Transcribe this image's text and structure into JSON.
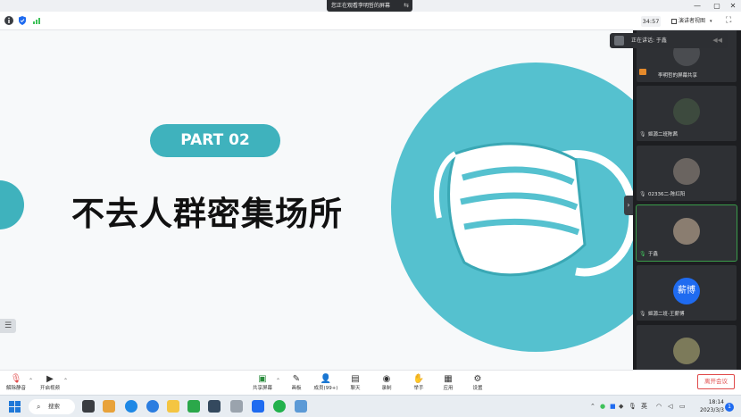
{
  "title_bar": {
    "sharing_text": "您正在观看李明哲的屏幕",
    "minimize": "—",
    "maximize": "▢",
    "close": "✕"
  },
  "info_bar": {
    "timer": "34:57",
    "view_mode": "演讲者视图",
    "icons": [
      "info-icon",
      "shield-icon",
      "signal-icon",
      "fullscreen-icon"
    ]
  },
  "slide": {
    "part_label": "PART 02",
    "title": "不去人群密集场所",
    "colors": {
      "teal": "#3fb2bd",
      "mask_circle": "#55c1cf"
    }
  },
  "panel": {
    "speaking_label": "正在讲话: 于鑫",
    "participants": [
      {
        "name": "李明哲的屏幕共享",
        "avatar": ""
      },
      {
        "name": "姬源二班陈茜",
        "avatar": ""
      },
      {
        "name": "02336二-陈红阳",
        "avatar": ""
      },
      {
        "name": "于鑫",
        "avatar": "",
        "speaking": true
      },
      {
        "name": "姬源二班-王薪博",
        "avatar": "薪博"
      },
      {
        "name": "",
        "avatar": ""
      }
    ]
  },
  "toolbar": {
    "unmute": "解除静音",
    "start_video": "开启视频",
    "share_screen": "共享屏幕",
    "whiteboard": "画板",
    "members": "成员(99+)",
    "chat": "聊天",
    "record": "录制",
    "raise_hand": "举手",
    "apps": "应用",
    "settings": "设置",
    "leave": "离开会议"
  },
  "taskbar": {
    "search": "搜索",
    "ime": "英",
    "time": "18:14",
    "date": "2023/3/3",
    "notifications": "1"
  }
}
